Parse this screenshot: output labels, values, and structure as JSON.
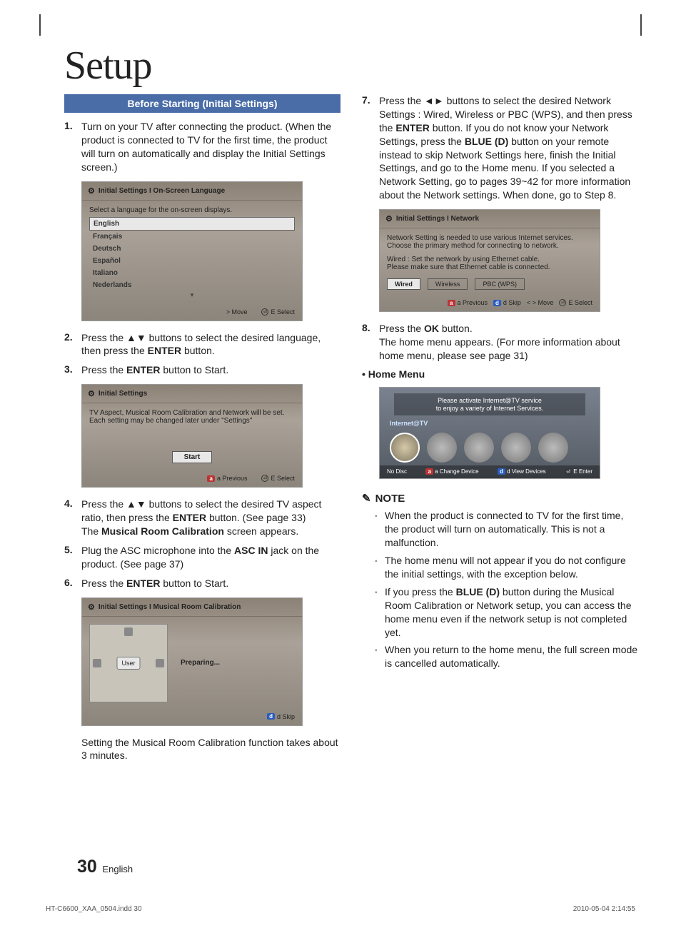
{
  "title": "Setup",
  "section_bar": "Before Starting (Initial Settings)",
  "left_steps": {
    "s1": {
      "num": "1.",
      "text": "Turn on your TV after connecting the product. (When the product is connected to TV for the first time, the product  will turn on automatically and display the Initial Settings screen.)"
    },
    "s2": {
      "num": "2.",
      "pre": "Press the ▲▼ buttons to select the desired language, then press the ",
      "bold": "ENTER",
      "post": " button."
    },
    "s3": {
      "num": "3.",
      "pre": "Press the ",
      "bold": "ENTER",
      "post": " button to Start."
    },
    "s4": {
      "num": "4.",
      "pre": "Press the ▲▼ buttons to select the desired TV aspect ratio, then press the ",
      "bold": "ENTER",
      "post": " button. (See page 33)",
      "line2a": "The ",
      "line2bold": "Musical Room Calibration",
      "line2b": " screen appears."
    },
    "s5": {
      "num": "5.",
      "pre": "Plug the ASC microphone into the ",
      "bold": "ASC IN",
      "post": " jack on the product. (See page 37)"
    },
    "s6": {
      "num": "6.",
      "pre": "Press the ",
      "bold": "ENTER",
      "post": " button to Start."
    }
  },
  "left_after_calib": "Setting the Musical Room Calibration function takes about 3 minutes.",
  "screen_lang": {
    "title": "Initial Settings I On-Screen Language",
    "instr": "Select a language for the on-screen displays.",
    "items": [
      "English",
      "Français",
      "Deutsch",
      "Español",
      "Italiano",
      "Nederlands"
    ],
    "foot_move": "> Move",
    "foot_select": "E Select"
  },
  "screen_start": {
    "title": "Initial Settings",
    "line1": "TV Aspect, Musical Room Calibration and Network will be set.",
    "line2": "Each setting may be changed later under \"Settings\"",
    "btn": "Start",
    "foot_prev": "a Previous",
    "foot_select": "E Select"
  },
  "screen_calib": {
    "title": "Initial Settings I Musical Room Calibration",
    "user": "User",
    "status": "Preparing...",
    "foot_skip": "d Skip"
  },
  "right_steps": {
    "s7": {
      "num": "7.",
      "t1": "Press the ◄► buttons to select the desired Network Settings : Wired, Wireless or PBC (WPS), and then press the ",
      "b1": "ENTER",
      "t2": " button. If you do not know your Network Settings, press the ",
      "b2": "BLUE (D)",
      "t3": " button on your remote instead to skip Network Settings here, finish the Initial Settings, and go to the Home menu. If you selected a Network Setting, go to pages 39~42 for more information about the Network settings. When done, go to Step 8."
    },
    "s8": {
      "num": "8.",
      "t1": "Press the ",
      "b1": "OK",
      "t2": " button.",
      "t3": "The home menu appears. (For more information about home menu, please see page 31)"
    }
  },
  "screen_net": {
    "title": "Initial Settings I Network",
    "line1": "Network Setting is needed to use various Internet services.",
    "line2": "Choose the primary method for connecting to network.",
    "line3": "Wired : Set the network by using Ethernet cable.",
    "line4": "Please make sure that Ethernet cable is connected.",
    "btn1": "Wired",
    "btn2": "Wireless",
    "btn3": "PBC (WPS)",
    "foot_prev": "a Previous",
    "foot_skip": "d Skip",
    "foot_move": "< > Move",
    "foot_select": "E Select"
  },
  "home_heading": "• Home Menu",
  "home": {
    "banner1": "Please activate Internet@TV service",
    "banner2": "to enjoy a variety of Internet Services.",
    "label": "Internet@TV",
    "foot_nodisc": "No Disc",
    "foot_change": "a Change Device",
    "foot_view": "d View Devices",
    "foot_enter": "E Enter"
  },
  "note_title": "NOTE",
  "notes": {
    "n1": "When the product is connected to TV for the first time, the product will turn on automatically. This is not a malfunction.",
    "n2": "The home menu will not appear if you do not configure the initial settings, with the exception below.",
    "n3a": "If you press the ",
    "n3b": "BLUE (D)",
    "n3c": " button during the Musical Room Calibration or Network setup, you can access the home menu even if the network setup is not completed yet.",
    "n4": "When you return to the home menu, the full screen mode is cancelled automatically."
  },
  "footer": {
    "page": "30",
    "lang": "English",
    "meta_left": "HT-C6600_XAA_0504.indd   30",
    "meta_right": "2010-05-04   2:14:55"
  }
}
